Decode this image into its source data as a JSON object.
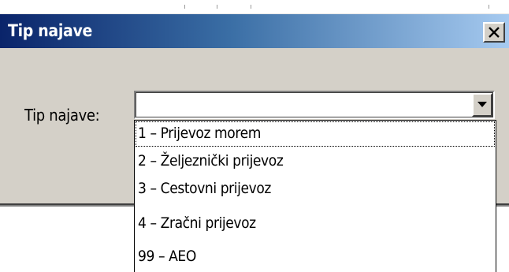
{
  "dialog": {
    "title": "Tip najave",
    "close_glyph": "X",
    "field_label": "Tip najave:",
    "combo_value": "",
    "combo_button_icon": "chevron-down-icon"
  },
  "dropdown": {
    "options": [
      {
        "label": "1 – Prijevoz morem",
        "focused": true
      },
      {
        "label": "2 – Željeznički prijevoz",
        "focused": false
      },
      {
        "label": "3 – Cestovni prijevoz",
        "focused": false
      },
      {
        "label": "4 – Zračni prijevoz",
        "focused": false
      },
      {
        "label": "99 – AEO",
        "focused": false
      }
    ]
  },
  "colors": {
    "titlebar_start": "#0a246a",
    "titlebar_end": "#a6caf0",
    "dialog_face": "#d4d0c8"
  }
}
